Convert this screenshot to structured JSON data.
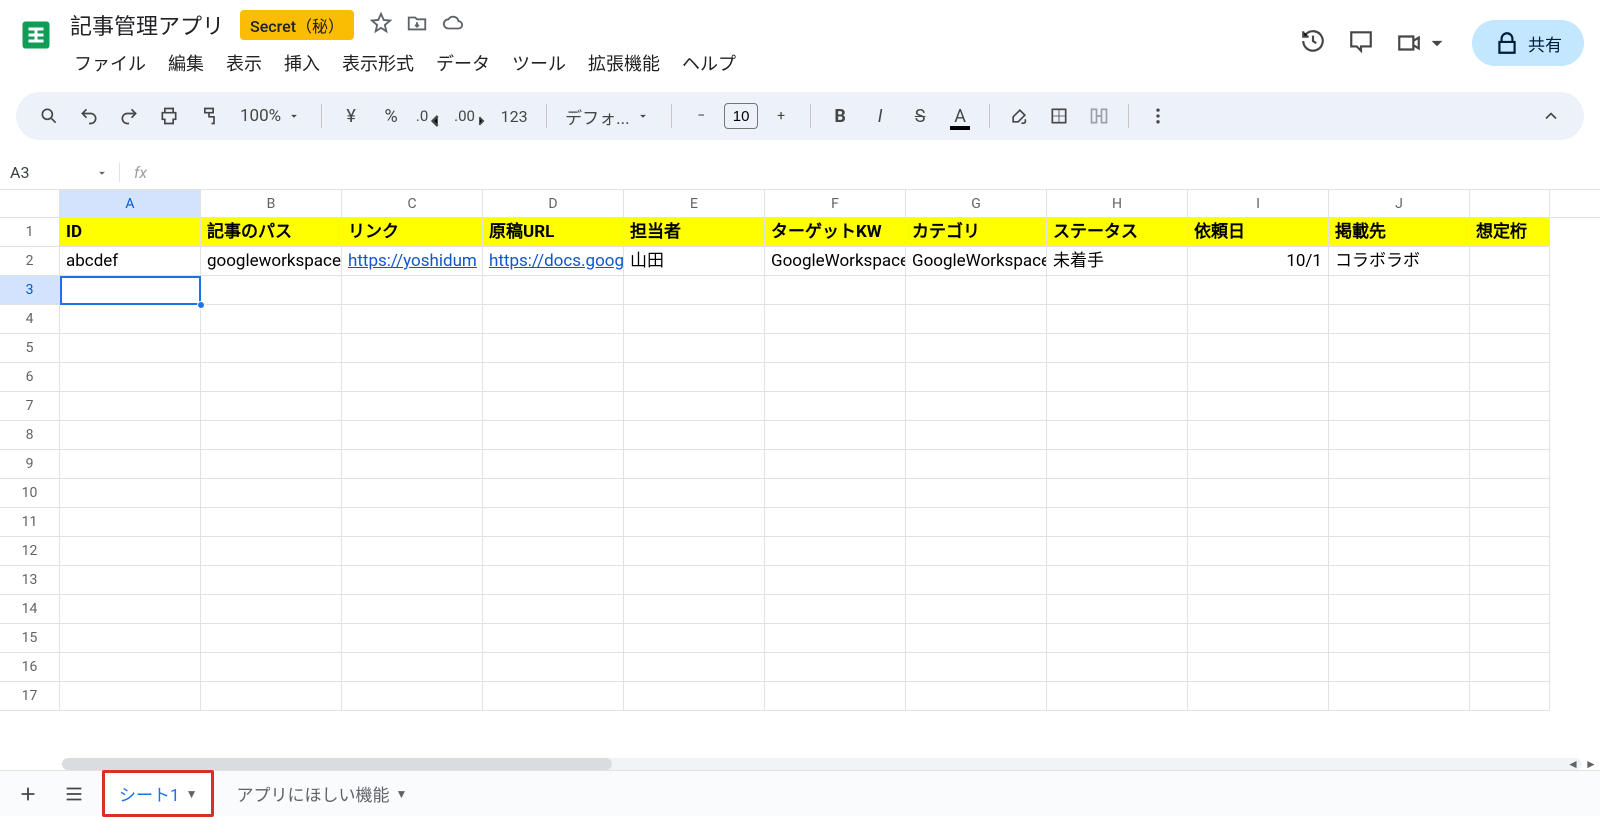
{
  "doc": {
    "title": "記事管理アプリ",
    "secret_badge": "Secret（秘）"
  },
  "menu": [
    "ファイル",
    "編集",
    "表示",
    "挿入",
    "表示形式",
    "データ",
    "ツール",
    "拡張機能",
    "ヘルプ"
  ],
  "share_label": "共有",
  "toolbar": {
    "zoom": "100%",
    "fmt_123": "123",
    "font_name": "デフォ...",
    "font_size": "10"
  },
  "name_box": "A3",
  "formula": "",
  "columns": [
    "A",
    "B",
    "C",
    "D",
    "E",
    "F",
    "G",
    "H",
    "I",
    "J"
  ],
  "last_col_fragment": "想定桁",
  "row_numbers": [
    1,
    2,
    3,
    4,
    5,
    6,
    7,
    8,
    9,
    10,
    11,
    12,
    13,
    14,
    15,
    16,
    17
  ],
  "header_row": [
    "ID",
    "記事のパス",
    "リンク",
    "原稿URL",
    "担当者",
    "ターゲットKW",
    "カテゴリ",
    "ステータス",
    "依頼日",
    "掲載先"
  ],
  "data_row": {
    "A": "abcdef",
    "B": "googleworkspace",
    "C": "https://yoshidum",
    "D": "https://docs.goog",
    "E": "山田",
    "F": "GoogleWorkspace",
    "G": "GoogleWorkspace",
    "H": "未着手",
    "I": "10/1",
    "J": "コラボラボ"
  },
  "selected_cell": "A3",
  "sheet_tabs": {
    "active": "シート1",
    "second": "アプリにほしい機能"
  }
}
